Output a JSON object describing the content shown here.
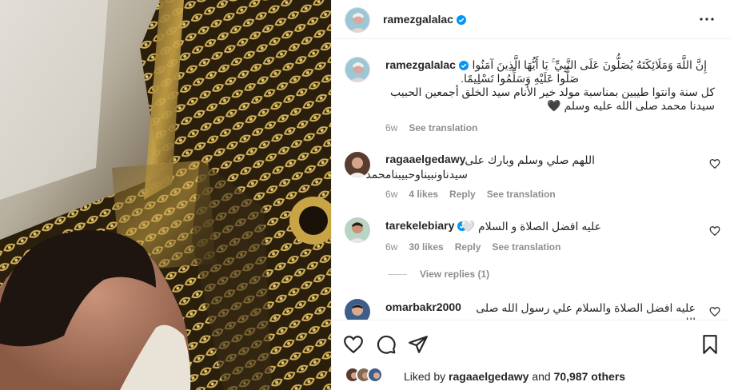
{
  "post": {
    "username": "ramezgalalac",
    "caption_username": "ramezgalalac",
    "caption_lines": [
      "إِنَّ اللَّهَ وَمَلَائِكَتَهُ يُصَلُّونَ عَلَى النَّبِيِّ ۚ يَا أَيُّهَا الَّذِينَ آمَنُوا",
      "صَلُّوا عَلَيْهِ وَسَلِّمُوا تَسْلِيمًا.",
      "كل سنة وانتوا طيبين بمناسبة مولد خير الأنام سيد الخلق أجمعين الحبيب",
      "سيدنا محمد صلى الله عليه وسلم 🖤"
    ],
    "caption_meta": {
      "time": "6w",
      "translation": "See translation"
    }
  },
  "comments": [
    {
      "username": "ragaaelgedawy",
      "lines": [
        "اللهم صلي وسلم وبارك على",
        "سيدناونبيناوحبيبنامحمد"
      ],
      "time": "6w",
      "likes": "4 likes",
      "reply": "Reply",
      "translation": "See translation"
    },
    {
      "username": "tarekelebiary",
      "lines": [
        "عليه افضل الصلاة و السلام 🤍"
      ],
      "time": "6w",
      "likes": "30 likes",
      "reply": "Reply",
      "translation": "See translation",
      "verified": true,
      "view_replies": "View replies (1)"
    },
    {
      "username": "omarbakr2000",
      "lines": [
        "عليه افضل الصلاة والسلام علي رسول الله صلى الله"
      ]
    }
  ],
  "likes": {
    "prefix": "Liked by",
    "liker": "ragaaelgedawy",
    "conj": "and",
    "others": "70,987 others"
  },
  "colors": {
    "verified": "#0095f6",
    "meta": "#8e8e8e",
    "text": "#262626"
  },
  "icons": [
    "more-icon",
    "verified-icon",
    "heart-icon",
    "comment-icon",
    "share-icon",
    "save-icon"
  ]
}
